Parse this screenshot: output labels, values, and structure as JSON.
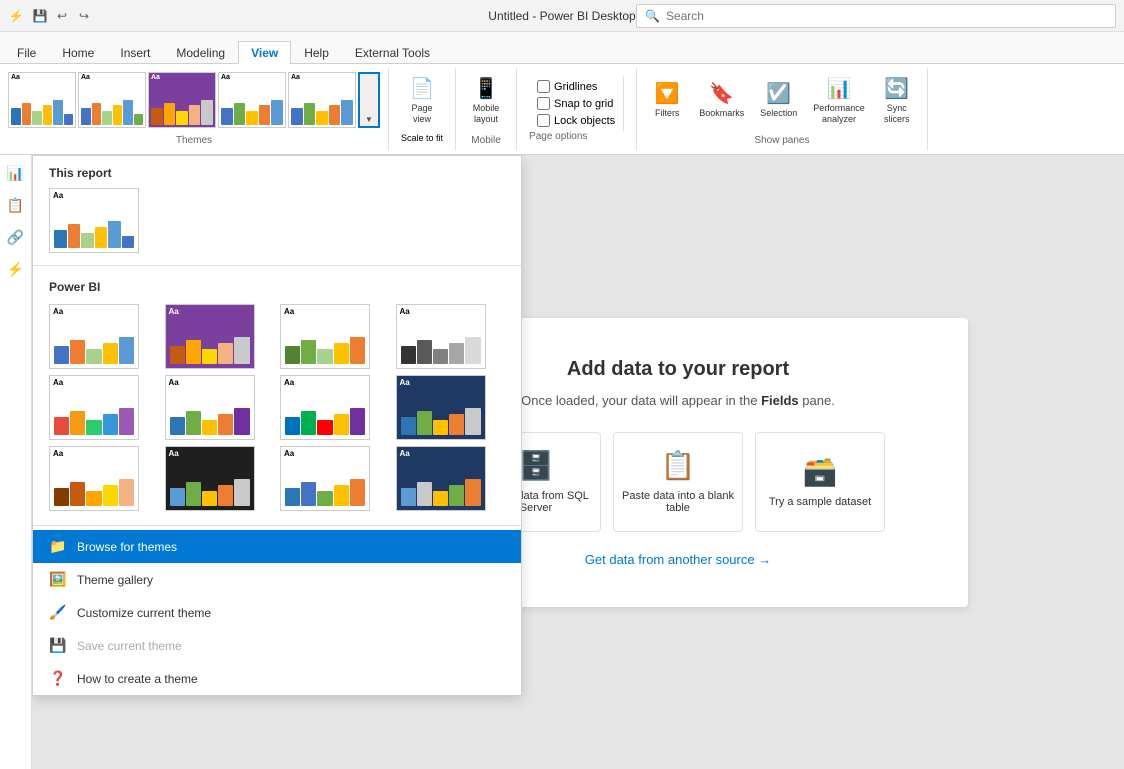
{
  "titleBar": {
    "title": "Untitled - Power BI Desktop",
    "searchPlaceholder": "Search"
  },
  "ribbon": {
    "tabs": [
      "File",
      "Home",
      "Insert",
      "Modeling",
      "View",
      "Help",
      "External Tools"
    ],
    "activeTab": "View",
    "groups": {
      "themes": {
        "label": "Themes",
        "themes": [
          {
            "id": "t1",
            "bg": "white",
            "bars": [
              "#2e75b6",
              "#ed7d31",
              "#a9d18e",
              "#ffc000",
              "#5b9bd5"
            ]
          },
          {
            "id": "t2",
            "bg": "white",
            "bars": [
              "#4472c4",
              "#ed7d31",
              "#a9d18e",
              "#ffc000",
              "#5b9bd5"
            ]
          },
          {
            "id": "t3",
            "bg": "#7b3f9e",
            "bars": [
              "#c55a11",
              "#833c00",
              "#ffc000",
              "#f4b183",
              "#c9c9c9"
            ]
          },
          {
            "id": "t4",
            "bg": "white",
            "bars": [
              "#4472c4",
              "#70ad47",
              "#ffc000",
              "#ed7d31",
              "#5b9bd5"
            ]
          },
          {
            "id": "t5",
            "bg": "white",
            "bars": [
              "#4472c4",
              "#70ad47",
              "#ffc000",
              "#ed7d31",
              "#5b9bd5"
            ]
          }
        ]
      },
      "pageView": {
        "label": "Page view",
        "items": [
          "Page view",
          "Scale to fit"
        ]
      },
      "mobile": {
        "label": "Mobile",
        "items": [
          "Mobile layout"
        ]
      },
      "pageOptions": {
        "label": "Page options",
        "gridlines": "Gridlines",
        "snapToGrid": "Snap to grid",
        "lockObjects": "Lock objects"
      },
      "showPanes": {
        "label": "Show panes",
        "items": [
          "Filters",
          "Bookmarks",
          "Selection",
          "Performance analyzer",
          "Sync slicers"
        ]
      }
    }
  },
  "canvas": {
    "title": "Add data to your report",
    "subtitle": "Once loaded, your data will appear in the",
    "subtitleBold": "Fields",
    "subtitleEnd": "pane.",
    "sources": [
      {
        "label": "Import data from SQL Server",
        "icon": "🗄️"
      },
      {
        "label": "Paste data into a blank table",
        "icon": "📋"
      },
      {
        "label": "Try a sample dataset",
        "icon": "🗃️"
      }
    ],
    "getDataLink": "Get data from another source →"
  },
  "themeDropdown": {
    "sections": {
      "thisReport": {
        "label": "This report",
        "themes": [
          {
            "id": "r1",
            "bg": "white",
            "bars": [
              "#2e75b6",
              "#ed7d31",
              "#a9d18e",
              "#ffc000",
              "#5b9bd5"
            ]
          }
        ]
      },
      "powerBI": {
        "label": "Power BI",
        "themes": [
          {
            "id": "p1",
            "bg": "white",
            "bars": [
              "#4472c4",
              "#ed7d31",
              "#a9d18e",
              "#ffc000",
              "#5b9bd5"
            ]
          },
          {
            "id": "p2",
            "bg": "#7b3f9e",
            "bars": [
              "#c55a11",
              "#ffa500",
              "#ffd700",
              "#f4b183",
              "#c9c9c9"
            ]
          },
          {
            "id": "p3",
            "bg": "white",
            "bars": [
              "#548235",
              "#70ad47",
              "#a9d18e",
              "#ffc000",
              "#ed7d31"
            ]
          },
          {
            "id": "p4",
            "bg": "white",
            "bars": [
              "#333333",
              "#595959",
              "#808080",
              "#a6a6a6",
              "#d9d9d9"
            ]
          },
          {
            "id": "p5",
            "bg": "white",
            "bars": [
              "#e74c3c",
              "#f39c12",
              "#2ecc71",
              "#3498db",
              "#9b59b6"
            ]
          },
          {
            "id": "p6",
            "bg": "white",
            "bars": [
              "#2e75b6",
              "#70ad47",
              "#ffc000",
              "#ed7d31",
              "#7030a0"
            ]
          },
          {
            "id": "p7",
            "bg": "white",
            "bars": [
              "#0070c0",
              "#00b050",
              "#ff0000",
              "#ffc000",
              "#7030a0"
            ]
          },
          {
            "id": "p8",
            "bg": "#1f3864",
            "bars": [
              "#2e75b6",
              "#70ad47",
              "#ffc000",
              "#ed7d31",
              "#c9c9c9"
            ]
          },
          {
            "id": "p9",
            "bg": "white",
            "bars": [
              "#833c00",
              "#c55a11",
              "#ffa500",
              "#ffd700",
              "#f4b183"
            ]
          },
          {
            "id": "p10",
            "bg": "#1f1f1f",
            "bars": [
              "#5b9bd5",
              "#70ad47",
              "#ffc000",
              "#ed7d31",
              "#c9c9c9"
            ]
          },
          {
            "id": "p11",
            "bg": "white",
            "bars": [
              "#2e75b6",
              "#4472c4",
              "#70ad47",
              "#ffc000",
              "#ed7d31"
            ]
          },
          {
            "id": "p12",
            "bg": "#1f3864",
            "bars": [
              "#5b9bd5",
              "#c9c9c9",
              "#ffc000",
              "#70ad47",
              "#ed7d31"
            ]
          }
        ]
      }
    },
    "menuItems": [
      {
        "id": "browse",
        "label": "Browse for themes",
        "icon": "📁",
        "highlighted": true
      },
      {
        "id": "gallery",
        "label": "Theme gallery",
        "icon": "🖼️"
      },
      {
        "id": "customize",
        "label": "Customize current theme",
        "icon": "🖌️"
      },
      {
        "id": "save",
        "label": "Save current theme",
        "icon": "💾",
        "disabled": true
      },
      {
        "id": "howto",
        "label": "How to create a theme",
        "icon": "❓"
      }
    ]
  }
}
